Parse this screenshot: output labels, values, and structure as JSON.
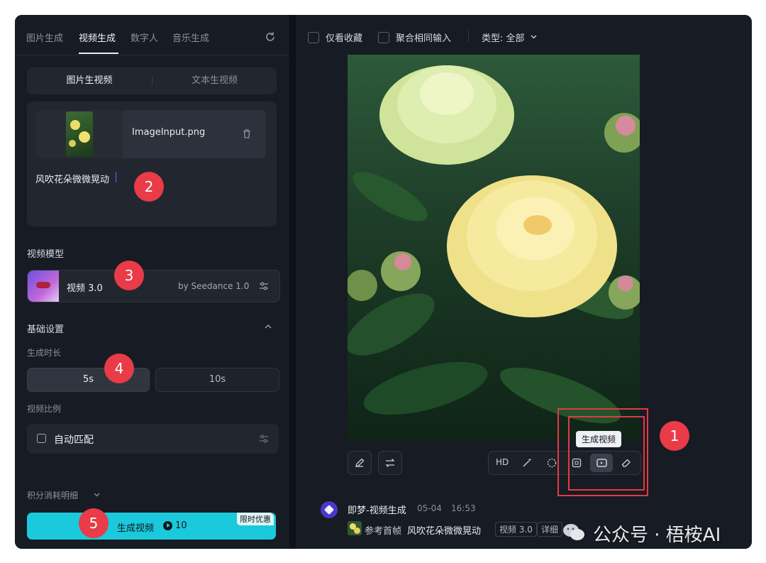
{
  "left_panel": {
    "tabs": [
      {
        "label": "图片生成"
      },
      {
        "label": "视频生成"
      },
      {
        "label": "数字人"
      },
      {
        "label": "音乐生成"
      }
    ],
    "mode_tabs": [
      {
        "label": "图片生视频"
      },
      {
        "label": "文本生视频"
      }
    ],
    "upload": {
      "file_name": "ImageInput.png",
      "prompt": "风吹花朵微微晃动"
    },
    "model": {
      "section_label": "视频模型",
      "name": "视频 3.0",
      "provider": "by Seedance 1.0"
    },
    "basic_settings": {
      "title": "基础设置",
      "duration_label": "生成时长",
      "duration_options": [
        {
          "label": "5s"
        },
        {
          "label": "10s"
        }
      ],
      "ratio_label": "视频比例",
      "ratio_value": "自动匹配"
    },
    "credits_detail": "积分消耗明细",
    "generate": {
      "label": "生成视频",
      "cost": "10",
      "promo": "限时优惠"
    }
  },
  "right_panel": {
    "filters": {
      "favorites_only": "仅看收藏",
      "merge_same_input": "聚合相同输入",
      "type_filter": "类型: 全部"
    },
    "toolbar": {
      "hd_label": "HD",
      "tooltip": "生成视频"
    },
    "history": {
      "title": "即梦-视频生成",
      "date": "05-04",
      "time": "16:53",
      "ref_label": "参考首帧",
      "prompt": "风吹花朵微微晃动",
      "model_tag": "视频 3.0",
      "detail_tag": "详细"
    }
  },
  "annotations": {
    "b1": "1",
    "b2": "2",
    "b3": "3",
    "b4": "4",
    "b5": "5"
  },
  "watermark": {
    "text": "公众号 · 梧桉AI"
  },
  "colors": {
    "accent": "#1bc9dc",
    "badge": "#e93b48",
    "panel": "#171b23",
    "field": "#252a33"
  }
}
